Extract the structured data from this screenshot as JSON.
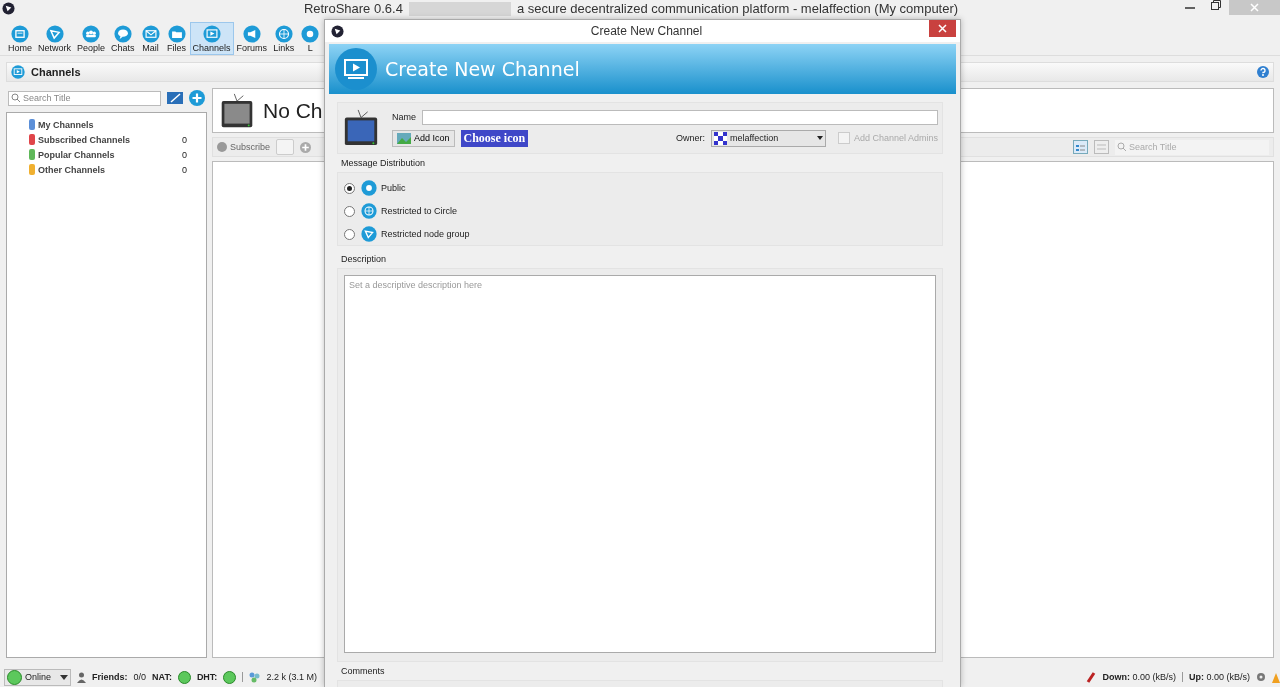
{
  "window": {
    "title_start": "RetroShare 0.6.4",
    "title_end": "a secure decentralized communication platform - melaffection (My computer)"
  },
  "toolbar": [
    {
      "label": "Home",
      "selected": false
    },
    {
      "label": "Network",
      "selected": false
    },
    {
      "label": "People",
      "selected": false
    },
    {
      "label": "Chats",
      "selected": false
    },
    {
      "label": "Mail",
      "selected": false
    },
    {
      "label": "Files",
      "selected": false
    },
    {
      "label": "Channels",
      "selected": true
    },
    {
      "label": "Forums",
      "selected": false
    },
    {
      "label": "Links",
      "selected": false
    },
    {
      "label": "L",
      "selected": false
    }
  ],
  "page_header": {
    "title": "Channels"
  },
  "sidebar": {
    "search_placeholder": "Search Title",
    "groups": [
      {
        "label": "My Channels",
        "color": "#5b8fd8"
      },
      {
        "label": "Subscribed Channels",
        "count": "0",
        "color": "#e0454a"
      },
      {
        "label": "Popular Channels",
        "count": "0",
        "color": "#5fb85a"
      },
      {
        "label": "Other Channels",
        "count": "0",
        "color": "#f0b030"
      }
    ]
  },
  "channel_view": {
    "title": "No Ch",
    "subscribe": "Subscribe",
    "search_placeholder": "Search Title"
  },
  "dialog": {
    "title": "Create New Channel",
    "banner": "Create New Channel",
    "name_label": "Name",
    "add_icon": "Add Icon",
    "choose_icon": "Choose icon",
    "owner_label": "Owner:",
    "owner": "melaffection",
    "add_admins": {
      "label": "Add Channel Admins",
      "checked": false,
      "disabled": true
    },
    "distribution": {
      "title": "Message Distribution",
      "options": [
        {
          "label": "Public",
          "selected": true
        },
        {
          "label": "Restricted to Circle",
          "selected": false
        },
        {
          "label": "Restricted node group",
          "selected": false
        }
      ]
    },
    "description": {
      "title": "Description",
      "placeholder": "Set a descriptive description here"
    },
    "comments": {
      "title": "Comments"
    }
  },
  "status_bar": {
    "status": "Online",
    "friends_label": "Friends:",
    "friends": "0/0",
    "nat": "NAT:",
    "dht": "DHT:",
    "peers": "2.2 k (3.1 M)",
    "down_label": "Down:",
    "down": "0.00 (kB/s)",
    "up_label": "Up:",
    "up": "0.00 (kB/s)"
  }
}
